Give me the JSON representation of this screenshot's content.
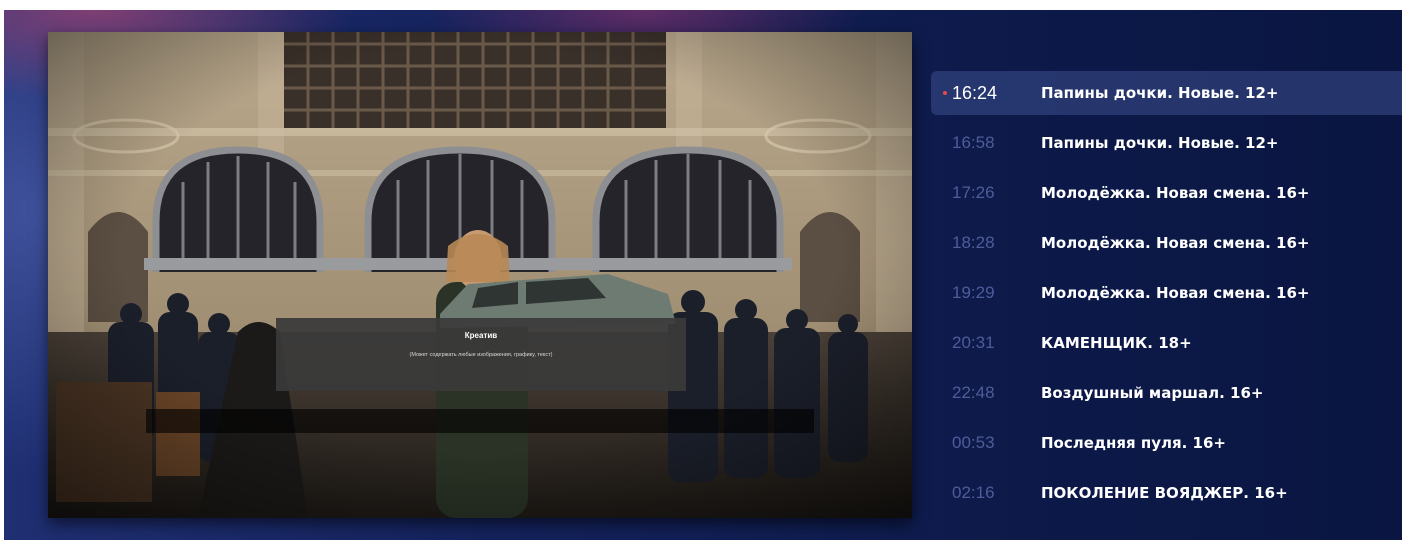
{
  "player": {
    "creative": {
      "title": "Креатив",
      "description": "(Может содержать любые изображения, графику, текст)"
    }
  },
  "schedule": {
    "items": [
      {
        "time": "16:24",
        "title": "Папины дочки. Новые. 12+",
        "current": true
      },
      {
        "time": "16:58",
        "title": "Папины дочки. Новые. 12+"
      },
      {
        "time": "17:26",
        "title": "Молодёжка. Новая смена. 16+"
      },
      {
        "time": "18:28",
        "title": "Молодёжка. Новая смена. 16+"
      },
      {
        "time": "19:29",
        "title": "Молодёжка. Новая смена. 16+"
      },
      {
        "time": "20:31",
        "title": "КАМЕНЩИК. 18+"
      },
      {
        "time": "22:48",
        "title": "Воздушный маршал. 16+"
      },
      {
        "time": "00:53",
        "title": "Последняя пуля. 16+"
      },
      {
        "time": "02:16",
        "title": "ПОКОЛЕНИЕ ВОЯДЖЕР. 16+"
      }
    ]
  },
  "colors": {
    "background": "#14225c",
    "live_indicator": "#e8474f",
    "time_inactive": "#4d5d9a"
  }
}
